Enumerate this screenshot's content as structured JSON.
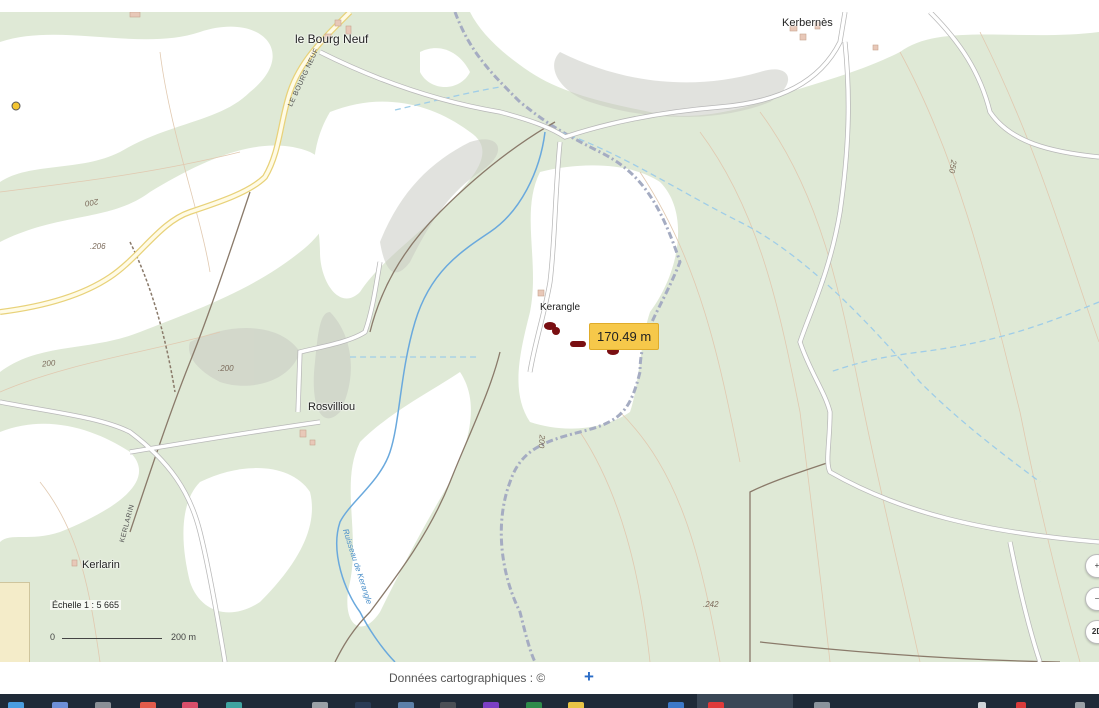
{
  "map": {
    "places": [
      {
        "key": "bourg_neuf",
        "label": "le Bourg Neuf"
      },
      {
        "key": "kerbernes",
        "label": "Kerbernès"
      },
      {
        "key": "kerangle",
        "label": "Kerangle"
      },
      {
        "key": "rosvilliou",
        "label": "Rosvilliou"
      },
      {
        "key": "kerlarin",
        "label": "Kerlarin"
      }
    ],
    "contour_labels": [
      "200",
      ".206",
      "200",
      ".200",
      "250",
      "200",
      ".242"
    ],
    "road_labels": [
      "LE BOURG NEUF",
      "KERLARIN"
    ],
    "water_labels": [
      "Ruisseau de Kerangle"
    ],
    "colors": {
      "forest": "#dfe9d6",
      "open_land": "#ffffff",
      "road": "#ffffff",
      "main_road_outline": "#e8d27a",
      "stream": "#6aa9dd",
      "boundary": "#a5acc2",
      "track": "#8a7a6a",
      "measure_marker": "#7a0f12",
      "tooltip_bg": "#f6c84a"
    }
  },
  "measurement": {
    "distance_label": "170.49 m"
  },
  "scale": {
    "text": "Échelle 1 : 5 665",
    "zero": "0",
    "distance": "200 m"
  },
  "controls": {
    "zoom_in_icon": "plus-icon",
    "zoom_out_icon": "minus-icon",
    "view_3d_label": "2D"
  },
  "attribution": {
    "text": "Données cartographiques : ©",
    "expand_icon": "plus-icon",
    "expand_symbol": "+"
  },
  "taskbar": {
    "icons": [
      "file-explorer-icon",
      "browser-icon",
      "app-icon",
      "chrome-icon",
      "app-icon",
      "app-icon",
      "app-icon",
      "app-icon",
      "app-icon",
      "onenote-icon",
      "excel-icon",
      "app-icon",
      "word-icon",
      "app-icon",
      "chevron-icon",
      "app-icon"
    ]
  }
}
